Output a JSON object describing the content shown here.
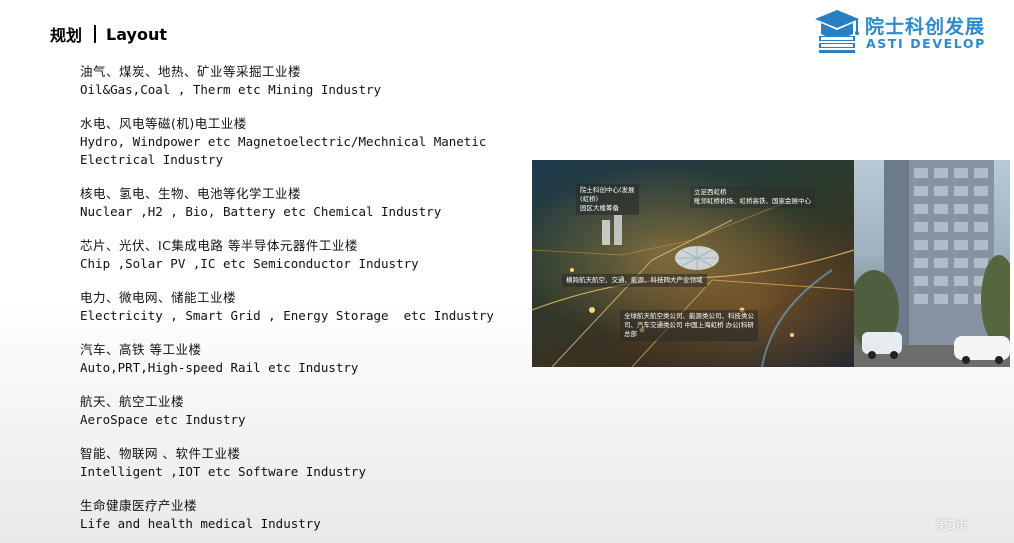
{
  "header": {
    "section": "规划",
    "title": "Layout"
  },
  "logo": {
    "cn": "院士科创发展",
    "en": "ASTI DEVELOP",
    "color": "#2e8bc8",
    "icon": "academic-cap-book-icon"
  },
  "items": [
    {
      "cn": "油气、煤炭、地热、矿业等采掘工业楼",
      "en": "Oil&Gas,Coal , Therm etc Mining Industry"
    },
    {
      "cn": "水电、风电等磁(机)电工业楼",
      "en": "Hydro, Windpower etc Magnetoelectric/Mechnical Manetic\nElectrical Industry"
    },
    {
      "cn": "核电、氢电、生物、电池等化学工业楼",
      "en": "Nuclear ,H2 , Bio, Battery etc Chemical Industry"
    },
    {
      "cn": "芯片、光伏、IC集成电路 等半导体元器件工业楼",
      "en": "Chip ,Solar PV ,IC etc Semiconductor Industry"
    },
    {
      "cn": "电力、微电网、储能工业楼",
      "en": "Electricity , Smart Grid , Energy Storage  etc Industry"
    },
    {
      "cn": "汽车、高铁 等工业楼",
      "en": "Auto,PRT,High-speed Rail etc Industry"
    },
    {
      "cn": "航天、航空工业楼",
      "en": "AeroSpace etc Industry"
    },
    {
      "cn": "智能、物联网 、软件工业楼",
      "en": "Intelligent ,IOT etc Software Industry"
    },
    {
      "cn": "生命健康医疗产业楼",
      "en": "Life and health medical Industry"
    }
  ],
  "map_labels": {
    "a": "院士科创中心(发展\n(虹桥)\n园区大楼筹备",
    "b": "立足西虹桥\n毗邻虹桥机场、虹桥高铁、国家会展中心",
    "c": "横跨航天航空、交通、能源、科技四大产业领域",
    "d": "全球航天航空类公司、能源类公司、科技类公\n司、汽车交通类公司 中国上海虹桥 办公|科研\n总部"
  },
  "page": {
    "label": "第3页"
  }
}
